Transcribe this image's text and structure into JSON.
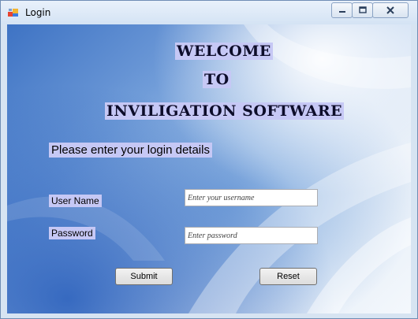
{
  "window": {
    "title": "Login"
  },
  "controls": {
    "minimize_icon": "minimize-icon",
    "maximize_icon": "maximize-icon",
    "close_icon": "close-icon"
  },
  "header": {
    "line1": "WELCOME",
    "line2": "TO",
    "line3": "INVILIGATION SOFTWARE"
  },
  "prompt": "Please enter your login details",
  "form": {
    "username_label": "User Name",
    "username_placeholder": "Enter your username",
    "username_value": "",
    "password_label": "Password",
    "password_placeholder": "Enter password",
    "password_value": ""
  },
  "buttons": {
    "submit": "Submit",
    "reset": "Reset"
  },
  "colors": {
    "label_background": "#c6c8f5",
    "window_border": "#6f8db5",
    "title_bar": "#dce8f5"
  }
}
